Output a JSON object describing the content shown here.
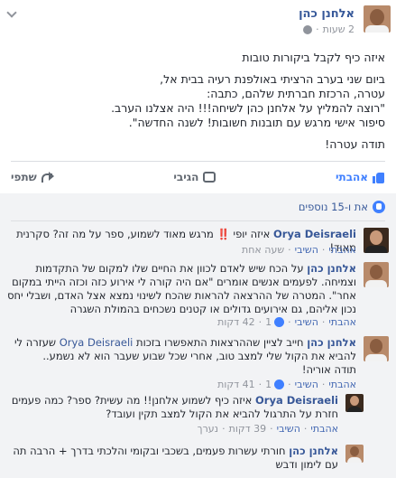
{
  "post": {
    "author": "אלחנן כהן",
    "time": "2 שעות",
    "text_lines": [
      "איזה כיף לקבל ביקורות טובות",
      "ביום שני בערב הרציתי באולפנת רעיה בבית אל,",
      "עטרה, הרכזת חברתית שלהם, כתבה:",
      "\"רוצה להמליץ על אלחנן כהן לשיחה!!! היה אצלנו הערב.",
      "סיפור אישי מרגש עם תובנות חשובות! לשנה החדשה\".",
      "תודה עטרה!"
    ]
  },
  "actions": {
    "like": "אהבתי",
    "comment": "הגיבי",
    "share": "שתפי"
  },
  "reactions": {
    "summary": "את ו-15 נוספים"
  },
  "comments": [
    {
      "name": "Orya Deisraeli",
      "text": "איזה יופי ‼️ מרגש מאוד לשמוע, ספר על מה זה? סקרנית מאוד!",
      "like": "אהבתי",
      "reply": "השיבי",
      "time": "שעה אחת"
    },
    {
      "name": "אלחנן כהן",
      "text": "על הכח שיש לאדם לכוון את החיים שלו למקום של התקדמות וצמיחה. לפעמים אנשים אומרים \"אם היה קורה לי אירוע כזה וכזה הייתי במקום אחר\". המטרה של ההרצאה להראות שהכח לשינוי נמצא אצל האדם, ושבלי יחס נכון אליהם, גם אירועים גדולים או קטנים נשכחים בהמולת השגרה",
      "like": "אהבתי",
      "reply": "השיבי",
      "count": "1",
      "time": "42 דקות"
    },
    {
      "name": "אלחנן כהן",
      "text_a": "חייב לציין שההרצאות התאפשרו בזכות",
      "mention": "Orya Deisraeli",
      "text_b": "שעזרה לי להביא את הקול שלי למצב טוב, אחרי שכל שבוע שעבר הוא לא נשמע..",
      "thanks": "תודה אוריה!",
      "like": "אהבתי",
      "reply": "השיבי",
      "count": "1",
      "time": "41 דקות"
    },
    {
      "name": "Orya Deisraeli",
      "text": "איזה כיף לשמוע אלחנן!! מה עשית? ספר? כמה פעמים חזרת על התרגול להביא את הקול למצב תקין ועובד?",
      "like": "אהבתי",
      "reply": "השיבי",
      "time": "39 דקות",
      "edited": "נערך"
    },
    {
      "name": "אלחנן כהן",
      "text": "חורתי עשרות פעמים, בשכבי ובקומי והלכתי בדרך + הרבה תה עם לימון ודבש"
    }
  ]
}
